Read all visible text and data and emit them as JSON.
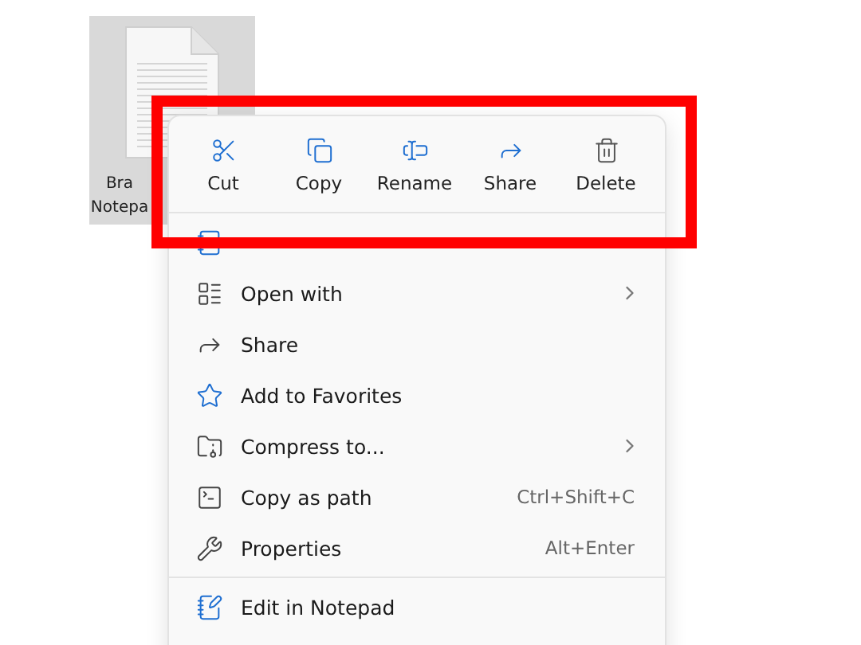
{
  "desktop_file": {
    "label_lines": [
      "Bra",
      "Notepa"
    ],
    "selected": true
  },
  "context_menu": {
    "toolbar": [
      {
        "label": "Cut"
      },
      {
        "label": "Copy"
      },
      {
        "label": "Rename"
      },
      {
        "label": "Share"
      },
      {
        "label": "Delete"
      }
    ],
    "groups": [
      [
        {
          "submenu": false
        },
        {
          "label": "Open with",
          "submenu": true
        },
        {
          "label": "Share",
          "submenu": false
        },
        {
          "label": "Add to Favorites",
          "submenu": false
        },
        {
          "label": "Compress to...",
          "submenu": true
        },
        {
          "label": "Copy as path",
          "shortcut": "Ctrl+Shift+C",
          "submenu": false
        },
        {
          "label": "Properties",
          "shortcut": "Alt+Enter",
          "submenu": false
        }
      ],
      [
        {
          "label": "Edit in Notepad",
          "submenu": false
        }
      ]
    ]
  },
  "annotation": {
    "kind": "highlight-rectangle",
    "color": "#ff0000"
  }
}
